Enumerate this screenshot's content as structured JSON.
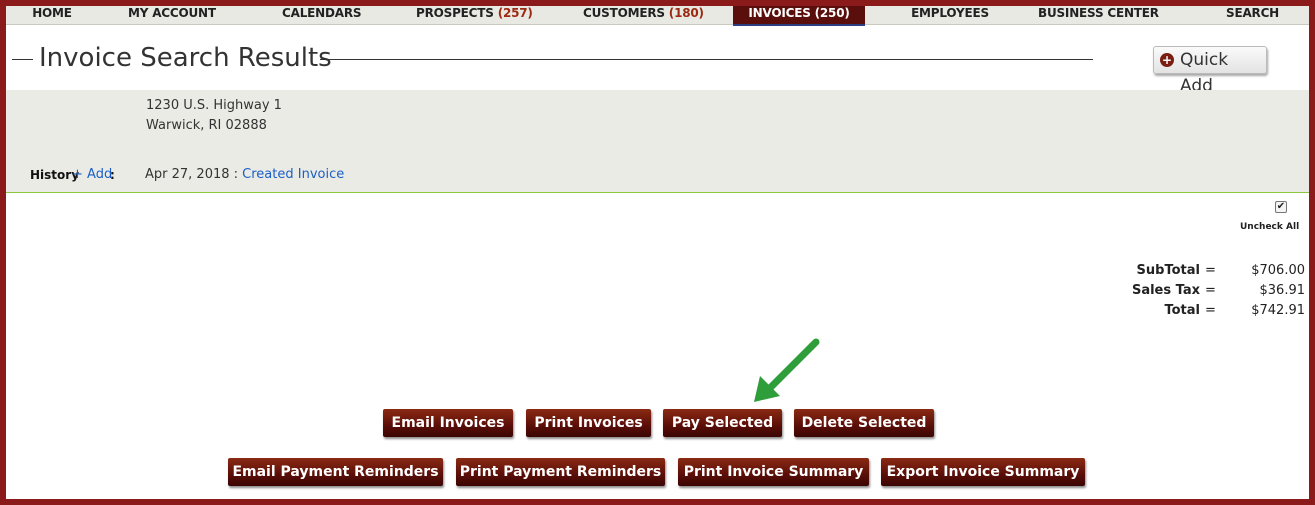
{
  "nav": {
    "home": "HOME",
    "my_account": "MY ACCOUNT",
    "calendars": "CALENDARS",
    "prospects": "PROSPECTS",
    "prospects_count": "(257)",
    "customers": "CUSTOMERS",
    "customers_count": "(180)",
    "invoices": "INVOICES",
    "invoices_count": "(250)",
    "employees": "EMPLOYEES",
    "business_center": "BUSINESS CENTER",
    "search": "SEARCH"
  },
  "page_title": "Invoice Search Results",
  "quick_add": {
    "icon": "plus-circle-icon",
    "label": "Quick Add"
  },
  "address": {
    "line1": "1230 U.S. Highway 1",
    "line2": "Warwick, RI 02888"
  },
  "history": {
    "label": "History",
    "add": "+ Add",
    "colon": ":",
    "date": "Apr 27, 2018 :",
    "event": "Created Invoice"
  },
  "uncheck_all": {
    "checked": true,
    "label": "Uncheck All"
  },
  "totals": {
    "subtotal_label": "SubTotal",
    "subtotal_value": "$706.00",
    "tax_label": "Sales Tax",
    "tax_value": "$36.91",
    "total_label": "Total",
    "total_value": "$742.91",
    "equals": "="
  },
  "actions_row1": {
    "email_invoices": "Email Invoices",
    "print_invoices": "Print Invoices",
    "pay_selected": "Pay Selected",
    "delete_selected": "Delete Selected"
  },
  "actions_row2": {
    "email_reminders": "Email Payment Reminders",
    "print_reminders": "Print Payment Reminders",
    "print_summary": "Print Invoice Summary",
    "export_summary": "Export Invoice Summary"
  },
  "colors": {
    "frame": "#8b1a1a",
    "button": "#5a0e08",
    "link": "#1a5fc8",
    "annotation_arrow": "#2e9e3a",
    "panel_border": "#8cc63f"
  }
}
